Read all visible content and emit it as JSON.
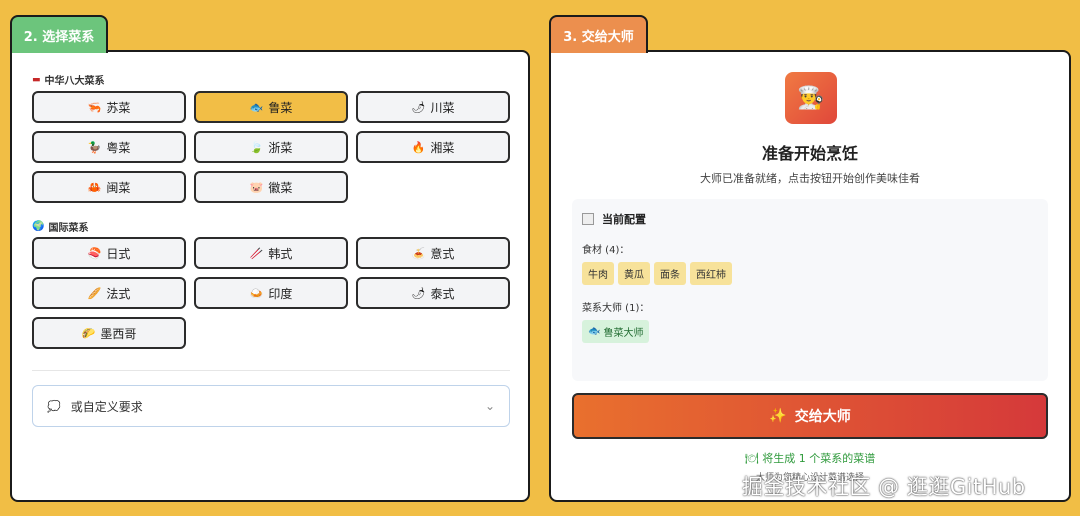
{
  "left": {
    "tab": "2. 选择菜系",
    "chinese": {
      "label": "中华八大菜系",
      "items": [
        {
          "emoji": "🦐",
          "label": "苏菜",
          "selected": false
        },
        {
          "emoji": "🐟",
          "label": "鲁菜",
          "selected": true
        },
        {
          "emoji": "🌶",
          "label": "川菜",
          "selected": false
        },
        {
          "emoji": "🦆",
          "label": "粤菜",
          "selected": false
        },
        {
          "emoji": "🍃",
          "label": "浙菜",
          "selected": false
        },
        {
          "emoji": "🔥",
          "label": "湘菜",
          "selected": false
        },
        {
          "emoji": "🦀",
          "label": "闽菜",
          "selected": false
        },
        {
          "emoji": "🐷",
          "label": "徽菜",
          "selected": false
        }
      ]
    },
    "international": {
      "label": "国际菜系",
      "items": [
        {
          "emoji": "🍣",
          "label": "日式",
          "selected": false
        },
        {
          "emoji": "🥢",
          "label": "韩式",
          "selected": false
        },
        {
          "emoji": "🍝",
          "label": "意式",
          "selected": false
        },
        {
          "emoji": "🥖",
          "label": "法式",
          "selected": false
        },
        {
          "emoji": "🍛",
          "label": "印度",
          "selected": false
        },
        {
          "emoji": "🌶",
          "label": "泰式",
          "selected": false
        },
        {
          "emoji": "🌮",
          "label": "墨西哥",
          "selected": false
        }
      ]
    },
    "custom_placeholder": "或自定义要求"
  },
  "right": {
    "tab": "3. 交给大师",
    "chef_emoji": "👨‍🍳",
    "title": "准备开始烹饪",
    "subtitle": "大师已准备就绪，点击按钮开始创作美味佳肴",
    "config": {
      "heading": "当前配置",
      "ingredients_label": "食材 (4)：",
      "ingredients": [
        "牛肉",
        "黄瓜",
        "面条",
        "西红柿"
      ],
      "masters_label": "菜系大师 (1)：",
      "masters": [
        {
          "emoji": "🐟",
          "label": "鲁菜大师"
        }
      ]
    },
    "button": {
      "icon": "✨",
      "label": "交给大师"
    },
    "gen_note": "🍽 将生成 1 个菜系的菜谱",
    "small_note": "大师为您精心设计菜谱选择"
  },
  "watermark": "掘金技术社区 @ 逛逛GitHub"
}
